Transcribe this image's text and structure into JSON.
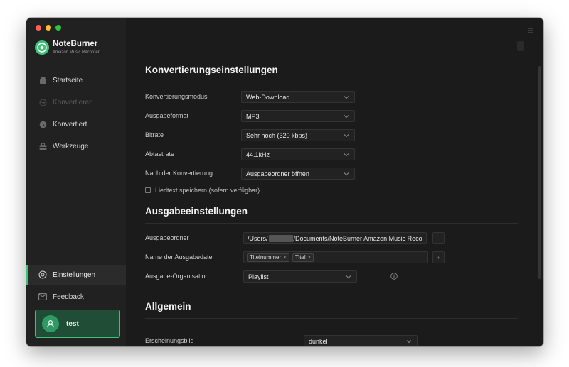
{
  "brand": {
    "name": "NoteBurner",
    "subtitle": "Amazon Music Recorder"
  },
  "colors": {
    "accent": "#3fbf77",
    "background": "#1b1b1b",
    "sidebar": "#212121"
  },
  "sidebar": {
    "items": [
      {
        "label": "Startseite",
        "icon": "home-icon"
      },
      {
        "label": "Konvertieren",
        "icon": "convert-icon"
      },
      {
        "label": "Konvertiert",
        "icon": "clock-icon"
      },
      {
        "label": "Werkzeuge",
        "icon": "toolbox-icon"
      }
    ],
    "bottom": [
      {
        "label": "Einstellungen",
        "icon": "gear-icon"
      },
      {
        "label": "Feedback",
        "icon": "mail-icon"
      }
    ],
    "user": {
      "name": "test"
    }
  },
  "conversion": {
    "title": "Konvertierungseinstellungen",
    "rows": [
      {
        "label": "Konvertierungsmodus",
        "value": "Web-Download"
      },
      {
        "label": "Ausgabeformat",
        "value": "MP3"
      },
      {
        "label": "Bitrate",
        "value": "Sehr hoch (320 kbps)"
      },
      {
        "label": "Abtastrate",
        "value": "44.1kHz"
      },
      {
        "label": "Nach der Konvertierung",
        "value": "Ausgabeordner öffnen"
      }
    ],
    "lyrics_checkbox": {
      "label": "Liedtext speichern (sofern verfügbar)",
      "checked": false
    }
  },
  "output": {
    "title": "Ausgabeeinstellungen",
    "folder": {
      "label": "Ausgabeordner",
      "path_prefix": "/Users/",
      "path_suffix": "/Documents/NoteBurner Amazon Music Reco",
      "browse": "···"
    },
    "filename": {
      "label": "Name der Ausgabedatei",
      "tags": [
        "Titelnummer",
        "Titel"
      ],
      "add": "+"
    },
    "organization": {
      "label": "Ausgabe-Organisation",
      "value": "Playlist"
    }
  },
  "general": {
    "title": "Allgemein",
    "appearance": {
      "label": "Erscheinungsbild",
      "value": "dunkel"
    }
  }
}
